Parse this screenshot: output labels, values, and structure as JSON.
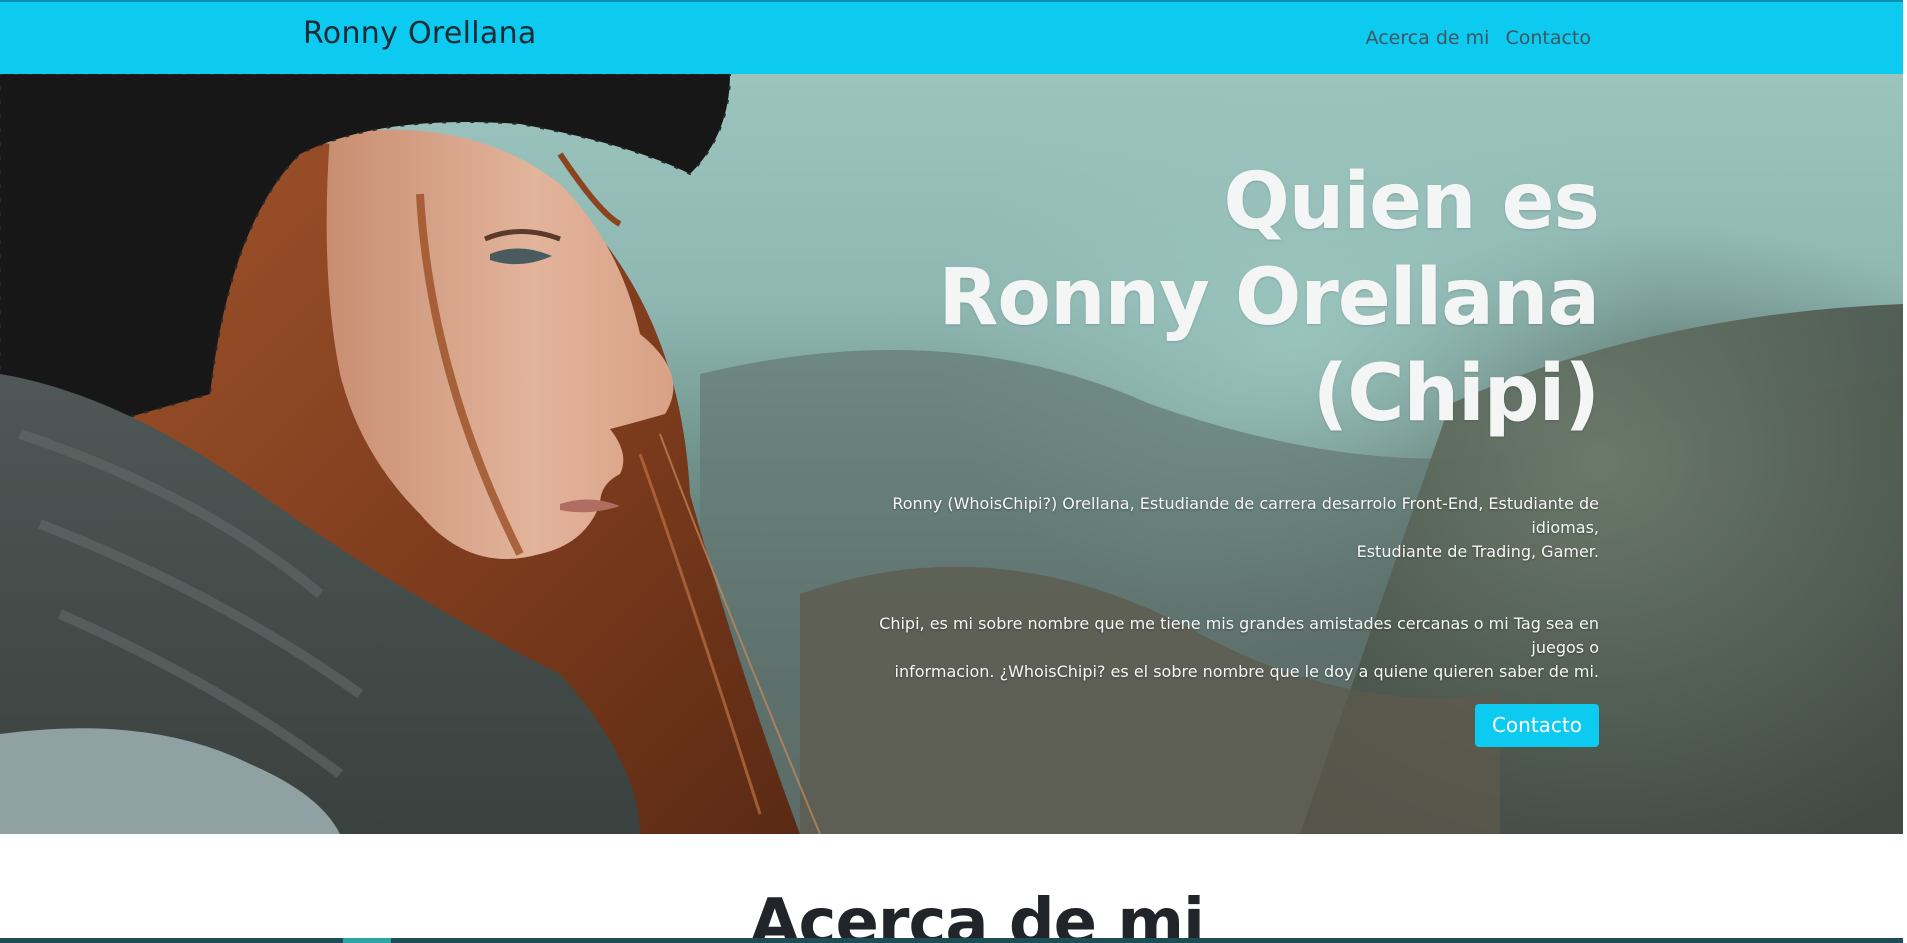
{
  "navbar": {
    "brand": "Ronny Orellana",
    "links": [
      {
        "label": "Acerca de mi"
      },
      {
        "label": "Contacto"
      }
    ]
  },
  "hero": {
    "title_line1": "Quien es",
    "title_line2": "Ronny Orellana",
    "title_line3": "(Chipi)",
    "paragraph1_line1": "Ronny (WhoisChipi?) Orellana, Estudiande de carrera desarrolo Front-End, Estudiante de idiomas,",
    "paragraph1_line2": "Estudiante de Trading, Gamer.",
    "paragraph2_line1": "Chipi, es mi sobre nombre que me tiene mis grandes amistades cercanas o mi Tag sea en juegos o",
    "paragraph2_line2": "informacion. ¿WhoisChipi? es el sobre nombre que le doy a quiene quieren saber de mi.",
    "button_label": "Contacto",
    "image_icon": "hero-photo-woman-portrait"
  },
  "about": {
    "title": "Acerca de mi"
  },
  "colors": {
    "accent": "#0dcaf0",
    "text_dark": "#212529"
  }
}
